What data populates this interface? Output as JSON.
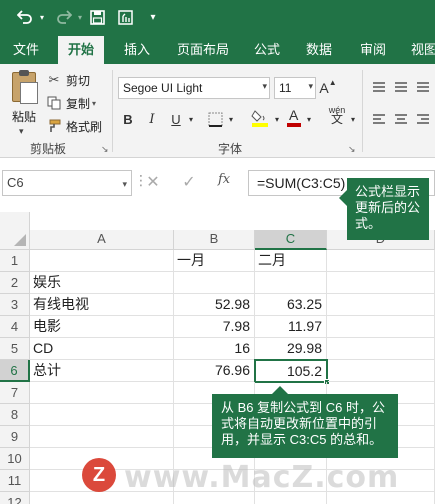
{
  "qat": {
    "undo_icon": "undo-icon",
    "redo_icon": "redo-icon",
    "save_icon": "save-icon",
    "touch_icon": "touch-mode-icon",
    "customize_icon": "customize-qat-icon"
  },
  "tabs": [
    {
      "label": "文件"
    },
    {
      "label": "开始"
    },
    {
      "label": "插入"
    },
    {
      "label": "页面布局"
    },
    {
      "label": "公式"
    },
    {
      "label": "数据"
    },
    {
      "label": "审阅"
    },
    {
      "label": "视图"
    }
  ],
  "clipboard": {
    "paste_label": "粘贴",
    "cut_label": "剪切",
    "copy_label": "复制",
    "format_painter_label": "格式刷",
    "group_label": "剪贴板"
  },
  "font": {
    "font_name": "Segoe UI Light",
    "font_size": "11",
    "bold": "B",
    "italic": "I",
    "underline": "U",
    "wen": "wén",
    "group_label": "字体",
    "fill_color": "#ffff00",
    "font_color": "#c00000"
  },
  "formula_bar": {
    "name_box": "C6",
    "cancel": "✕",
    "enter": "✓",
    "fx": "fx",
    "formula": "=SUM(C3:C5)"
  },
  "callouts": {
    "formula_note": "公式栏显示更新后的公式。",
    "copy_note": "从 B6 复制公式到 C6 时，公式将自动更改新位置中的引用，并显示 C3:C5 的总和。"
  },
  "sheet": {
    "columns": [
      "A",
      "B",
      "C",
      "D"
    ],
    "rows": [
      "1",
      "2",
      "3",
      "4",
      "5",
      "6",
      "7",
      "8",
      "9",
      "10",
      "11",
      "12"
    ],
    "cells": {
      "B1": "一月",
      "C1": "二月",
      "A2": "娱乐",
      "A3": "有线电视",
      "B3": "52.98",
      "C3": "63.25",
      "A4": "电影",
      "B4": "7.98",
      "C4": "11.97",
      "A5": "CD",
      "B5": "16",
      "C5": "29.98",
      "A6": "总计",
      "B6": "76.96",
      "C6": "105.2"
    },
    "selected_cell": "C6",
    "accent_color": "#217346"
  },
  "watermark": {
    "logo": "Z",
    "text": "www.MacZ.com"
  }
}
